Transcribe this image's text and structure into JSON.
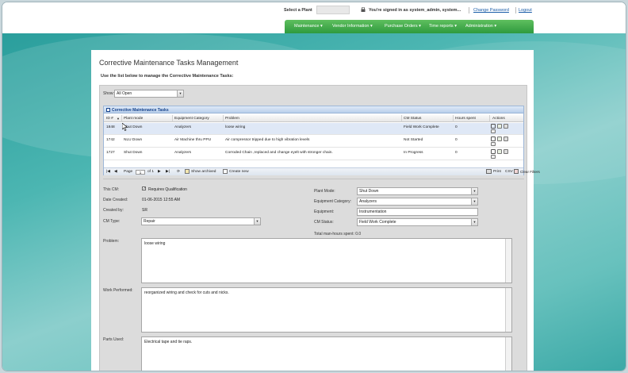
{
  "header": {
    "plant_label": "Select a Plant",
    "signed_in_text": "You're signed in as system_admin, system...",
    "change_password": "Change Password",
    "logout": "Logout"
  },
  "nav": {
    "items": [
      "Maintenance ▾",
      "Vendor Information ▾",
      "Purchase Orders ▾",
      "Time reports ▾",
      "Administration ▾"
    ]
  },
  "page": {
    "title": "Corrective Maintenance Tasks Management",
    "instructions": "Use the list below to manage the Corrective Maintenance Tasks:"
  },
  "filter": {
    "show_label": "Show:",
    "show_value": "All Open"
  },
  "grid": {
    "title": "Corrective Maintenance Tasks",
    "columns": [
      "ID #",
      "Plant mode",
      "Equipment Category",
      "Problem",
      "CM Status",
      "Hours spent",
      "Actions"
    ],
    "rows": [
      {
        "id": "1848",
        "plant_mode": "Shut Down",
        "category": "Analyzers",
        "problem": "loose wiring",
        "status": "Field Work Complete",
        "hours": "0"
      },
      {
        "id": "1742",
        "plant_mode": "NLU Down",
        "category": "Air Machine thru PPU",
        "problem": "Air compressor tripped due to high vibration levels",
        "status": "Not Started",
        "hours": "0"
      },
      {
        "id": "1727",
        "plant_mode": "Shut Down",
        "category": "Analyzers",
        "problem": "Corroded Chain ,replaced and change eyelt with stronger chain.",
        "status": "In Progress",
        "hours": "0"
      }
    ],
    "footer": {
      "page_label": "Page",
      "page_value": "1",
      "of_label": "of 1",
      "show_archived": "Show archived",
      "create_new": "Create new",
      "print": "Print",
      "csv": "CSV",
      "clear_filters": "Clear Filters"
    }
  },
  "form": {
    "this_cm_label": "This CM:",
    "requires_qualification": "Requires Qualification",
    "date_created_label": "Date Created:",
    "date_created_value": "01-06-2015 12:55 AM",
    "created_by_label": "Created by:",
    "created_by_value": "SR",
    "cm_type_label": "CM Type:",
    "cm_type_value": "Repair",
    "plant_mode_label": "Plant Mode:",
    "plant_mode_value": "Shut Down",
    "equipment_category_label": "Equipment Category:",
    "equipment_category_value": "Analyzers",
    "equipment_label": "Equipment:",
    "equipment_value": "Instrumentation",
    "cm_status_label": "CM Status:",
    "cm_status_value": "Field Work Complete",
    "total_hours": "Total man-hours spent: 0.0",
    "problem_label": "Problem:",
    "problem_value": "loose wiring",
    "work_performed_label": "Work Performed:",
    "work_performed_value": "reorganized wiring and check for cuts and nicks.",
    "parts_used_label": "Parts Used:",
    "parts_used_value": "Electrical tape and tie raps."
  },
  "icons": [
    "lock-icon",
    "edit-icon",
    "copy-icon",
    "print-icon",
    "delete-icon",
    "first-page-icon",
    "prev-page-icon",
    "next-page-icon",
    "last-page-icon",
    "refresh-icon",
    "archive-icon",
    "create-icon",
    "printer-icon",
    "clear-filter-icon"
  ],
  "colors": {
    "nav_green": "#2e9a3e",
    "grid_header_blue": "#b9cfeb",
    "link_blue": "#1a5da8",
    "selected_row": "#dfe8f6"
  }
}
